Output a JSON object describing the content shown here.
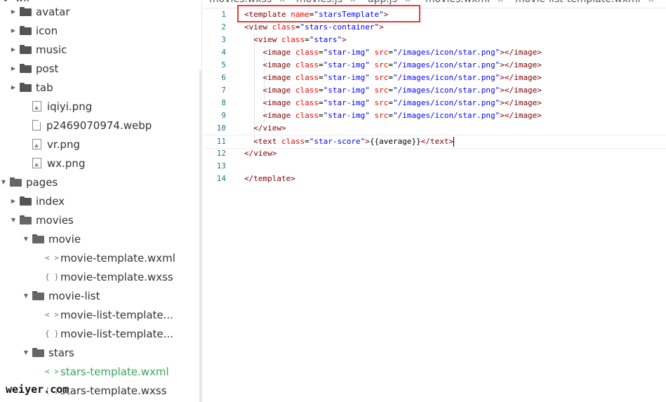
{
  "sidebar": {
    "top_label": "wx",
    "items": [
      {
        "label": "avatar",
        "kind": "folder",
        "arrow": "right"
      },
      {
        "label": "icon",
        "kind": "folder",
        "arrow": "right"
      },
      {
        "label": "music",
        "kind": "folder",
        "arrow": "right"
      },
      {
        "label": "post",
        "kind": "folder",
        "arrow": "right"
      },
      {
        "label": "tab",
        "kind": "folder",
        "arrow": "right"
      },
      {
        "label": "iqiyi.png",
        "kind": "image"
      },
      {
        "label": "p2469070974.webp",
        "kind": "file"
      },
      {
        "label": "vr.png",
        "kind": "image"
      },
      {
        "label": "wx.png",
        "kind": "image"
      },
      {
        "label": "pages",
        "kind": "folder",
        "arrow": "down"
      },
      {
        "label": "index",
        "kind": "folder",
        "arrow": "right"
      },
      {
        "label": "movies",
        "kind": "folder",
        "arrow": "down"
      },
      {
        "label": "movie",
        "kind": "folder",
        "arrow": "down"
      },
      {
        "label": "movie-template.wxml",
        "kind": "wxml",
        "icon": "< >"
      },
      {
        "label": "movie-template.wxss",
        "kind": "wxss",
        "icon": "{ }"
      },
      {
        "label": "movie-list",
        "kind": "folder",
        "arrow": "down"
      },
      {
        "label": "movie-list-template...",
        "kind": "wxml",
        "icon": "< >"
      },
      {
        "label": "movie-list-template...",
        "kind": "wxss",
        "icon": "{ }"
      },
      {
        "label": "stars",
        "kind": "folder",
        "arrow": "down"
      },
      {
        "label": "stars-template.wxml",
        "kind": "wxml",
        "icon": "< >",
        "active": true
      },
      {
        "label": "stars-template.wxss",
        "kind": "wxss",
        "icon": "{ }"
      }
    ]
  },
  "watermark": "weiyer.com",
  "tabs": [
    {
      "label": "movies.wxss",
      "close": "×"
    },
    {
      "label": "movies.js",
      "close": "×"
    },
    {
      "label": "app.js",
      "close": "×"
    },
    {
      "label": "movies.wxml",
      "close": "×"
    },
    {
      "label": "movie-list-template.wxml",
      "close": "×"
    }
  ],
  "editor": {
    "lines": [
      {
        "n": "1",
        "tokens": [
          {
            "c": "tg",
            "t": "<template "
          },
          {
            "c": "at",
            "t": "name"
          },
          {
            "c": "tx",
            "t": "="
          },
          {
            "c": "st",
            "t": "\"starsTemplate\""
          },
          {
            "c": "tg",
            "t": ">"
          }
        ]
      },
      {
        "n": "2",
        "tokens": [
          {
            "c": "tg",
            "t": "<view "
          },
          {
            "c": "at",
            "t": "class"
          },
          {
            "c": "tx",
            "t": "="
          },
          {
            "c": "st",
            "t": "\"stars-container\""
          },
          {
            "c": "tg",
            "t": ">"
          }
        ]
      },
      {
        "n": "3",
        "tokens": [
          {
            "c": "tx",
            "t": "  "
          },
          {
            "c": "tg",
            "t": "<view "
          },
          {
            "c": "at",
            "t": "class"
          },
          {
            "c": "tx",
            "t": "="
          },
          {
            "c": "st",
            "t": "\"stars\""
          },
          {
            "c": "tg",
            "t": ">"
          }
        ]
      },
      {
        "n": "4",
        "tokens": [
          {
            "c": "tx",
            "t": "    "
          },
          {
            "c": "tg",
            "t": "<image "
          },
          {
            "c": "at",
            "t": "class"
          },
          {
            "c": "tx",
            "t": "="
          },
          {
            "c": "st",
            "t": "\"star-img\""
          },
          {
            "c": "tx",
            "t": " "
          },
          {
            "c": "at",
            "t": "src"
          },
          {
            "c": "tx",
            "t": "="
          },
          {
            "c": "st",
            "t": "\"/images/icon/star.png\""
          },
          {
            "c": "tg",
            "t": "></image>"
          }
        ]
      },
      {
        "n": "5",
        "tokens": [
          {
            "c": "tx",
            "t": "    "
          },
          {
            "c": "tg",
            "t": "<image "
          },
          {
            "c": "at",
            "t": "class"
          },
          {
            "c": "tx",
            "t": "="
          },
          {
            "c": "st",
            "t": "\"star-img\""
          },
          {
            "c": "tx",
            "t": " "
          },
          {
            "c": "at",
            "t": "src"
          },
          {
            "c": "tx",
            "t": "="
          },
          {
            "c": "st",
            "t": "\"/images/icon/star.png\""
          },
          {
            "c": "tg",
            "t": "></image>"
          }
        ]
      },
      {
        "n": "6",
        "tokens": [
          {
            "c": "tx",
            "t": "    "
          },
          {
            "c": "tg",
            "t": "<image "
          },
          {
            "c": "at",
            "t": "class"
          },
          {
            "c": "tx",
            "t": "="
          },
          {
            "c": "st",
            "t": "\"star-img\""
          },
          {
            "c": "tx",
            "t": " "
          },
          {
            "c": "at",
            "t": "src"
          },
          {
            "c": "tx",
            "t": "="
          },
          {
            "c": "st",
            "t": "\"/images/icon/star.png\""
          },
          {
            "c": "tg",
            "t": "></image>"
          }
        ]
      },
      {
        "n": "7",
        "tokens": [
          {
            "c": "tx",
            "t": "    "
          },
          {
            "c": "tg",
            "t": "<image "
          },
          {
            "c": "at",
            "t": "class"
          },
          {
            "c": "tx",
            "t": "="
          },
          {
            "c": "st",
            "t": "\"star-img\""
          },
          {
            "c": "tx",
            "t": " "
          },
          {
            "c": "at",
            "t": "src"
          },
          {
            "c": "tx",
            "t": "="
          },
          {
            "c": "st",
            "t": "\"/images/icon/star.png\""
          },
          {
            "c": "tg",
            "t": "></image>"
          }
        ]
      },
      {
        "n": "8",
        "tokens": [
          {
            "c": "tx",
            "t": "    "
          },
          {
            "c": "tg",
            "t": "<image "
          },
          {
            "c": "at",
            "t": "class"
          },
          {
            "c": "tx",
            "t": "="
          },
          {
            "c": "st",
            "t": "\"star-img\""
          },
          {
            "c": "tx",
            "t": " "
          },
          {
            "c": "at",
            "t": "src"
          },
          {
            "c": "tx",
            "t": "="
          },
          {
            "c": "st",
            "t": "\"/images/icon/star.png\""
          },
          {
            "c": "tg",
            "t": "></image>"
          }
        ]
      },
      {
        "n": "9",
        "tokens": [
          {
            "c": "tx",
            "t": "    "
          },
          {
            "c": "tg",
            "t": "<image "
          },
          {
            "c": "at",
            "t": "class"
          },
          {
            "c": "tx",
            "t": "="
          },
          {
            "c": "st",
            "t": "\"star-img\""
          },
          {
            "c": "tx",
            "t": " "
          },
          {
            "c": "at",
            "t": "src"
          },
          {
            "c": "tx",
            "t": "="
          },
          {
            "c": "st",
            "t": "\"/images/icon/star.png\""
          },
          {
            "c": "tg",
            "t": "></image>"
          }
        ]
      },
      {
        "n": "10",
        "tokens": [
          {
            "c": "tx",
            "t": "  "
          },
          {
            "c": "tg",
            "t": "</view>"
          }
        ]
      },
      {
        "n": "11",
        "tokens": [
          {
            "c": "tx",
            "t": "  "
          },
          {
            "c": "tg",
            "t": "<text "
          },
          {
            "c": "at",
            "t": "class"
          },
          {
            "c": "tx",
            "t": "="
          },
          {
            "c": "st",
            "t": "\"star-score\""
          },
          {
            "c": "tg",
            "t": ">"
          },
          {
            "c": "tx",
            "t": "{{average}}"
          },
          {
            "c": "tg",
            "t": "</text>"
          }
        ]
      },
      {
        "n": "12",
        "tokens": [
          {
            "c": "tg",
            "t": "</view>"
          }
        ]
      },
      {
        "n": "13",
        "tokens": []
      },
      {
        "n": "14",
        "tokens": [
          {
            "c": "tg",
            "t": "</template>"
          }
        ]
      }
    ]
  },
  "colors": {
    "tag": "#800000",
    "attribute": "#ff0000",
    "string": "#0000ff",
    "line_number": "#237893",
    "active_file": "#3ba55c",
    "highlight_box": "#e03a3a"
  }
}
